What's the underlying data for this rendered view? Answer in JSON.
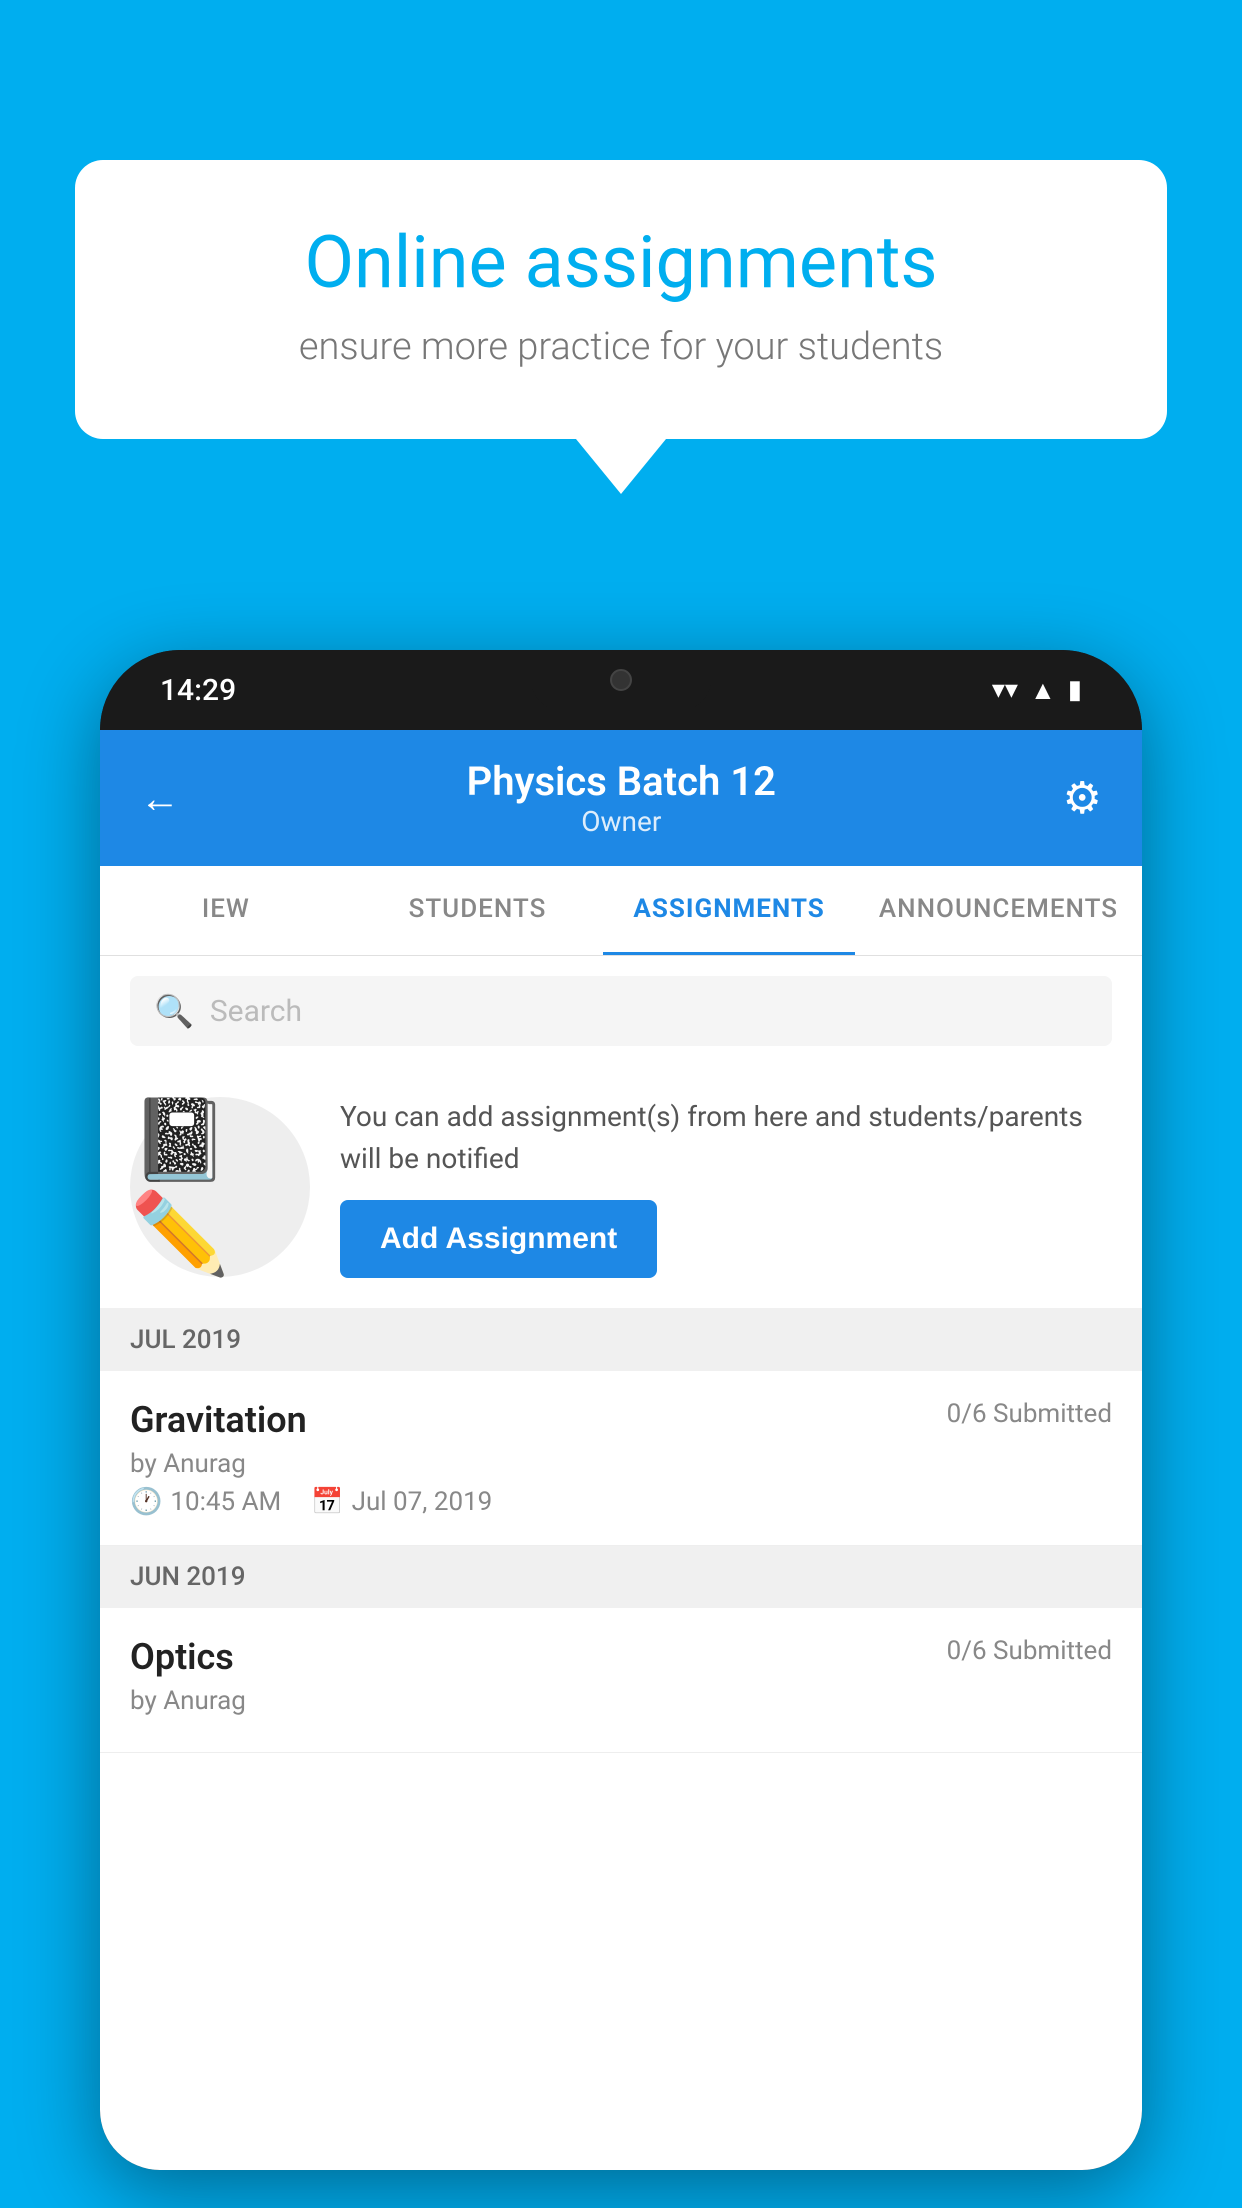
{
  "background_color": "#00AEEF",
  "speech_bubble": {
    "title": "Online assignments",
    "subtitle": "ensure more practice for your students"
  },
  "phone": {
    "status_bar": {
      "time": "14:29",
      "icons": [
        "wifi",
        "signal",
        "battery"
      ]
    },
    "header": {
      "title": "Physics Batch 12",
      "subtitle": "Owner",
      "back_label": "←",
      "settings_label": "⚙"
    },
    "tabs": [
      {
        "label": "IEW",
        "active": false
      },
      {
        "label": "STUDENTS",
        "active": false
      },
      {
        "label": "ASSIGNMENTS",
        "active": true
      },
      {
        "label": "ANNOUNCEMENTS",
        "active": false
      }
    ],
    "search": {
      "placeholder": "Search"
    },
    "promo": {
      "text": "You can add assignment(s) from here and students/parents will be notified",
      "button_label": "Add Assignment"
    },
    "sections": [
      {
        "header": "JUL 2019",
        "assignments": [
          {
            "name": "Gravitation",
            "submitted": "0/6 Submitted",
            "by": "by Anurag",
            "time": "10:45 AM",
            "date": "Jul 07, 2019"
          }
        ]
      },
      {
        "header": "JUN 2019",
        "assignments": [
          {
            "name": "Optics",
            "submitted": "0/6 Submitted",
            "by": "by Anurag",
            "time": "",
            "date": ""
          }
        ]
      }
    ]
  }
}
